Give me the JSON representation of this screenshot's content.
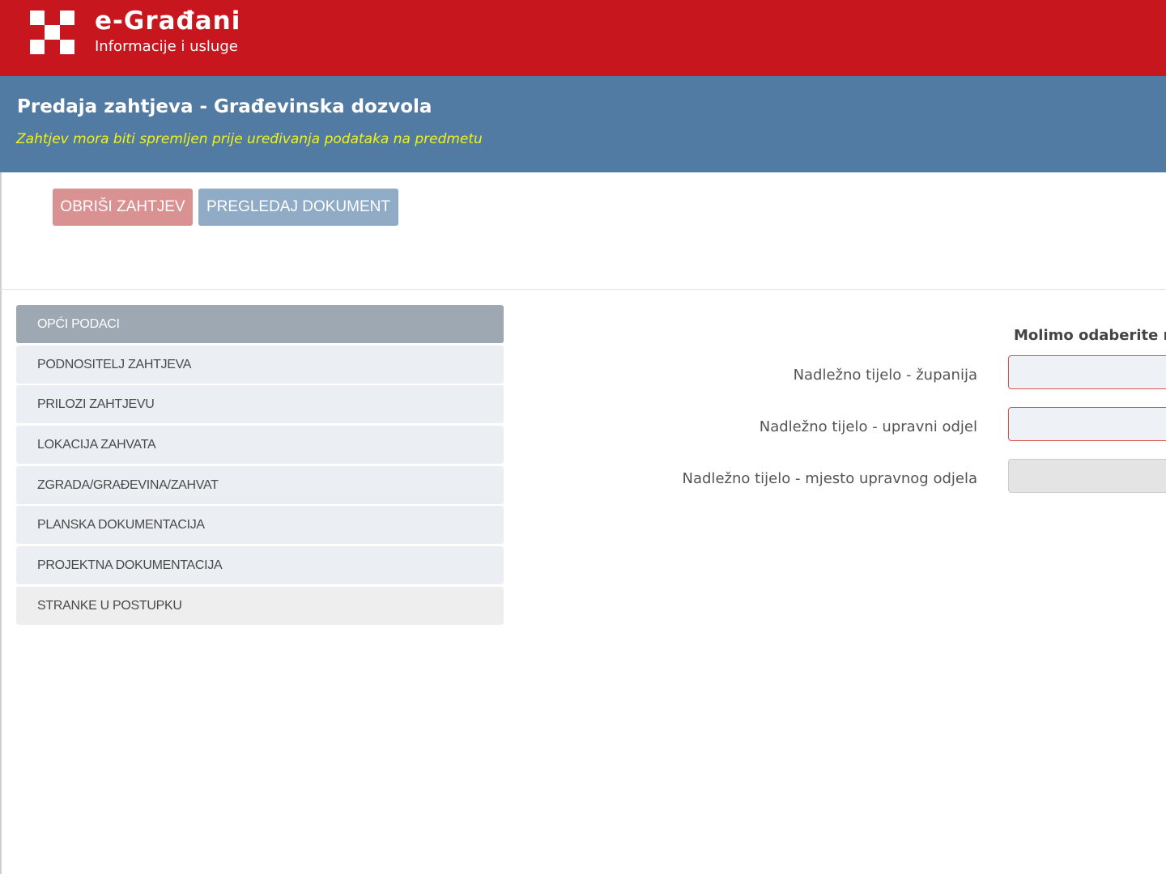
{
  "app": {
    "title": "e-Građani",
    "subtitle": "Informacije i usluge",
    "logo": "checkerboard-logo",
    "brand_color": "#c8161e"
  },
  "page": {
    "title": "Predaja zahtjeva - Građevinska dozvola",
    "notice": "Zahtjev mora biti spremljen prije uređivanja podataka na predmetu",
    "header_color": "#517ba2"
  },
  "actions": {
    "delete_label": "OBRIŠI ZAHTJEV",
    "preview_label": "PREGLEDAJ DOKUMENT"
  },
  "sidebar": {
    "items": [
      {
        "label": "OPĆI PODACI",
        "active": true
      },
      {
        "label": "PODNOSITELJ ZAHTJEVA",
        "active": false
      },
      {
        "label": "PRILOZI ZAHTJEVU",
        "active": false
      },
      {
        "label": "LOKACIJA ZAHVATA",
        "active": false
      },
      {
        "label": "ZGRADA/GRAĐEVINA/ZAHVAT",
        "active": false
      },
      {
        "label": "PLANSKA DOKUMENTACIJA",
        "active": false
      },
      {
        "label": "PROJEKTNA DOKUMENTACIJA",
        "active": false
      },
      {
        "label": "STRANKE U POSTUPKU",
        "active": false
      }
    ]
  },
  "form": {
    "heading": "Molimo odaberite na",
    "fields": [
      {
        "label": "Nadležno tijelo - županija",
        "value": "",
        "state": "required"
      },
      {
        "label": "Nadležno tijelo - upravni odjel",
        "value": "",
        "state": "required"
      },
      {
        "label": "Nadležno tijelo - mjesto upravnog odjela",
        "value": "",
        "state": "disabled"
      }
    ]
  }
}
